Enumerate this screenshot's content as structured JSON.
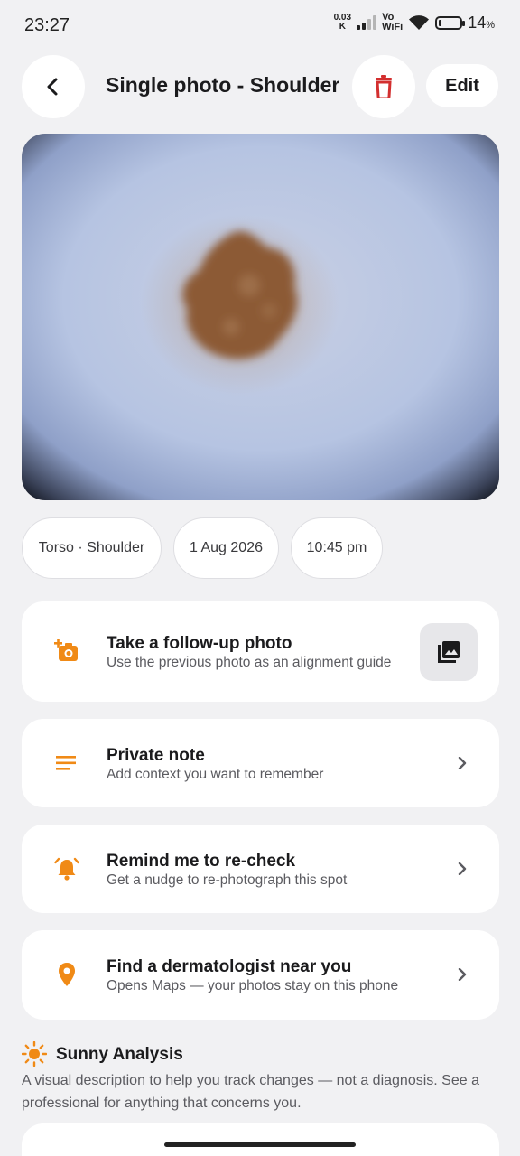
{
  "status_bar": {
    "time": "23:27",
    "net_speed_value": "0.03",
    "net_speed_unit": "K",
    "vo_label": "Vo",
    "wifi_label": "WiFi",
    "battery_level": 14,
    "battery_percent": "14",
    "battery_percent_sign": "%"
  },
  "header": {
    "title": "Single photo - Shoulder",
    "edit_label": "Edit",
    "back_icon": "arrow-left",
    "delete_icon": "trash",
    "delete_color": "#d32f2f"
  },
  "photo": {
    "subject": "skin lesion close-up"
  },
  "chips": {
    "location": "Torso · Shoulder",
    "date": "1 Aug 2026",
    "time": "10:45 pm"
  },
  "actions": [
    {
      "icon": "camera-plus",
      "title": "Take a follow-up photo",
      "subtitle": "Use the previous photo as an alignment guide",
      "trailing_icon": "gallery"
    },
    {
      "icon": "note-lines",
      "title": "Private note",
      "subtitle": "Add context you want to remember",
      "trailing_icon": "chevron-right"
    },
    {
      "icon": "alarm-bell",
      "title": "Remind me to re-check",
      "subtitle": "Get a nudge to re-photograph this spot",
      "trailing_icon": "chevron-right"
    },
    {
      "icon": "map-pin",
      "title": "Find a dermatologist near you",
      "subtitle": "Opens Maps — your photos stay on this phone",
      "trailing_icon": "chevron-right"
    }
  ],
  "analysis": {
    "icon": "sun",
    "title": "Sunny Analysis",
    "description": "A visual description to help you track changes — not a diagnosis. See a professional for anything that concerns you."
  },
  "colors": {
    "accent": "#f08a16",
    "background": "#f1f1f3",
    "card": "#ffffff"
  }
}
